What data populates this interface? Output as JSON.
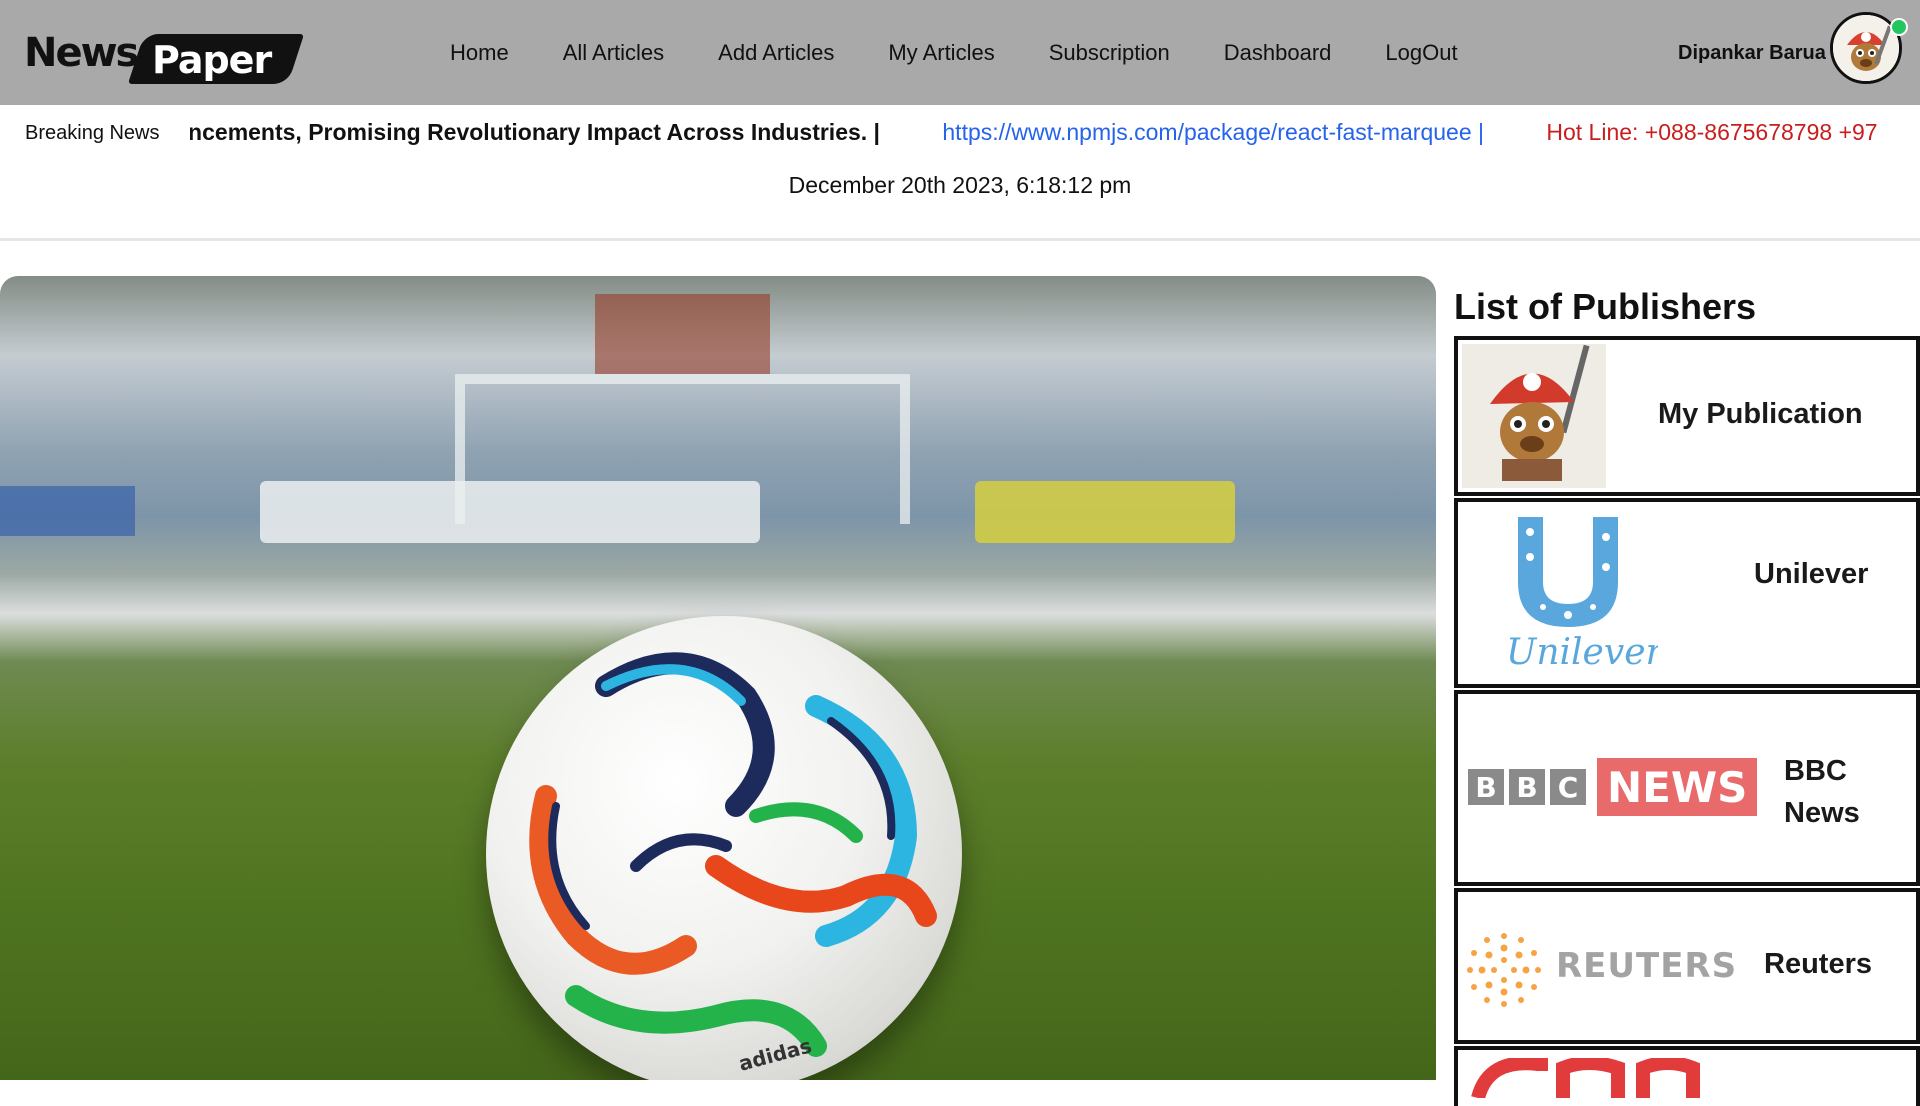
{
  "header": {
    "logo_news": "News",
    "logo_paper": "Paper",
    "nav": [
      {
        "label": "Home"
      },
      {
        "label": "All Articles"
      },
      {
        "label": "Add Articles"
      },
      {
        "label": "My Articles"
      },
      {
        "label": "Subscription"
      },
      {
        "label": "Dashboard"
      },
      {
        "label": "LogOut"
      }
    ],
    "user_name": "Dipankar Barua",
    "online_color": "#22c55e"
  },
  "ticker": {
    "label": "Breaking News",
    "items": [
      "Cutting-Edge Technological Advancements, Promising Revolutionary Impact Across Industries. |",
      "https://www.npmjs.com/package/react-fast-marquee |",
      "Hot Line: +088-8675678798 +97"
    ],
    "item_colors": [
      "#111111",
      "#2563eb",
      "#c81e1e"
    ]
  },
  "datetime": "December 20th 2023, 6:18:12 pm",
  "hero": {
    "image_alt": "football-on-pitch",
    "ball_brand": "adidas"
  },
  "sidebar": {
    "title": "List of Publishers",
    "publishers": [
      {
        "name": "My Publication",
        "logo": "cartoon-avatar"
      },
      {
        "name": "Unilever",
        "logo": "unilever-logo",
        "logo_text": "Unilever"
      },
      {
        "name": "BBC News",
        "name_line1": "BBC",
        "name_line2": "News",
        "logo": "bbc-news-logo",
        "logo_letters": [
          "B",
          "B",
          "C"
        ],
        "logo_news": "NEWS"
      },
      {
        "name": "Reuters",
        "logo": "reuters-logo",
        "logo_text": "REUTERS"
      },
      {
        "name": "",
        "logo": "cnn-logo"
      }
    ]
  }
}
